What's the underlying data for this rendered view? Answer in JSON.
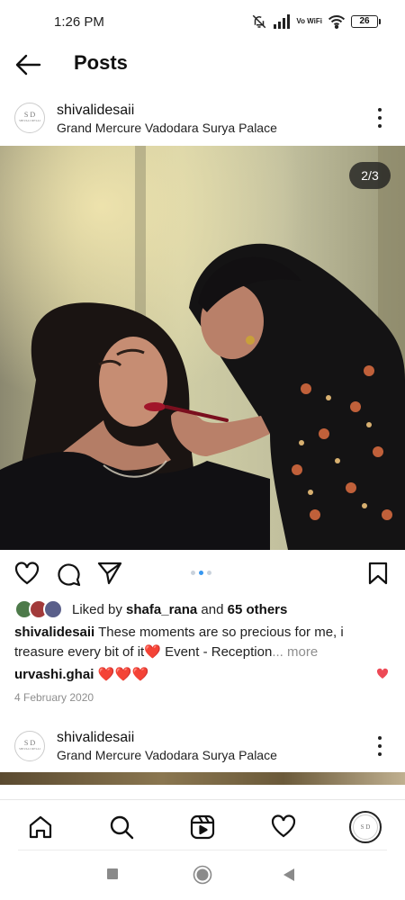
{
  "status_bar": {
    "time": "1:26 PM",
    "network": "Vo WiFi",
    "battery": "26"
  },
  "header": {
    "title": "Posts"
  },
  "post": {
    "username": "shivalidesaii",
    "location": "Grand Mercure Vadodara Surya Palace",
    "image_counter": "2/3",
    "likes": {
      "prefix": "Liked by ",
      "user": "shafa_rana",
      "joiner": " and ",
      "others": "65 others"
    },
    "caption": {
      "username": "shivalidesaii",
      "text": " These moments are so precious for me, i treasure every bit of it❤️ Event - Reception",
      "more": "... more"
    },
    "comment": {
      "username": "urvashi.ghai",
      "text": "❤️❤️❤️"
    },
    "date": "4 February 2020"
  },
  "next_post": {
    "username": "shivalidesaii",
    "location": "Grand Mercure Vadodara Surya Palace"
  },
  "avatar_monogram": {
    "initials": "S D",
    "small": "SHIVALI DESAI"
  },
  "colors": {
    "accent": "#3797f0",
    "heart": "#ed4956",
    "muted": "#8e8e8e"
  }
}
